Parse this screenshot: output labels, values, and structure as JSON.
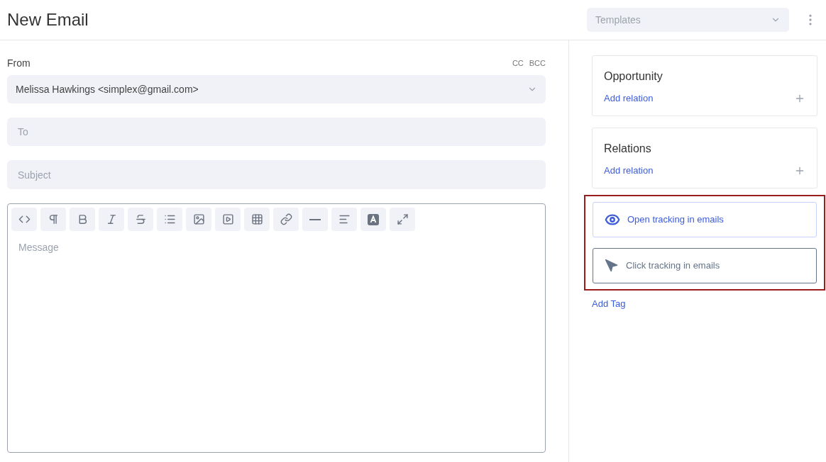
{
  "header": {
    "title": "New Email",
    "templates": {
      "placeholder": "Templates"
    }
  },
  "from": {
    "label": "From",
    "cc": "CC",
    "bcc": "BCC",
    "value": "Melissa Hawkings <simplex@gmail.com>"
  },
  "to": {
    "placeholder": "To"
  },
  "subject": {
    "placeholder": "Subject"
  },
  "toolbar": [
    {
      "kind": "code"
    },
    {
      "kind": "paragraph"
    },
    {
      "kind": "bold"
    },
    {
      "kind": "italic"
    },
    {
      "kind": "strike"
    },
    {
      "kind": "list"
    },
    {
      "kind": "image"
    },
    {
      "kind": "video"
    },
    {
      "kind": "table"
    },
    {
      "kind": "link"
    },
    {
      "kind": "rule"
    },
    {
      "kind": "align"
    },
    {
      "kind": "color"
    },
    {
      "kind": "expand"
    }
  ],
  "message": {
    "placeholder": "Message"
  },
  "panels": [
    {
      "title": "Opportunity",
      "link": "Add relation"
    },
    {
      "title": "Relations",
      "link": "Add relation"
    }
  ],
  "tracking": [
    {
      "kind": "open",
      "label": "Open tracking in emails",
      "on": true
    },
    {
      "kind": "click",
      "label": "Click tracking in emails",
      "on": false
    }
  ],
  "add_tag": "Add Tag"
}
